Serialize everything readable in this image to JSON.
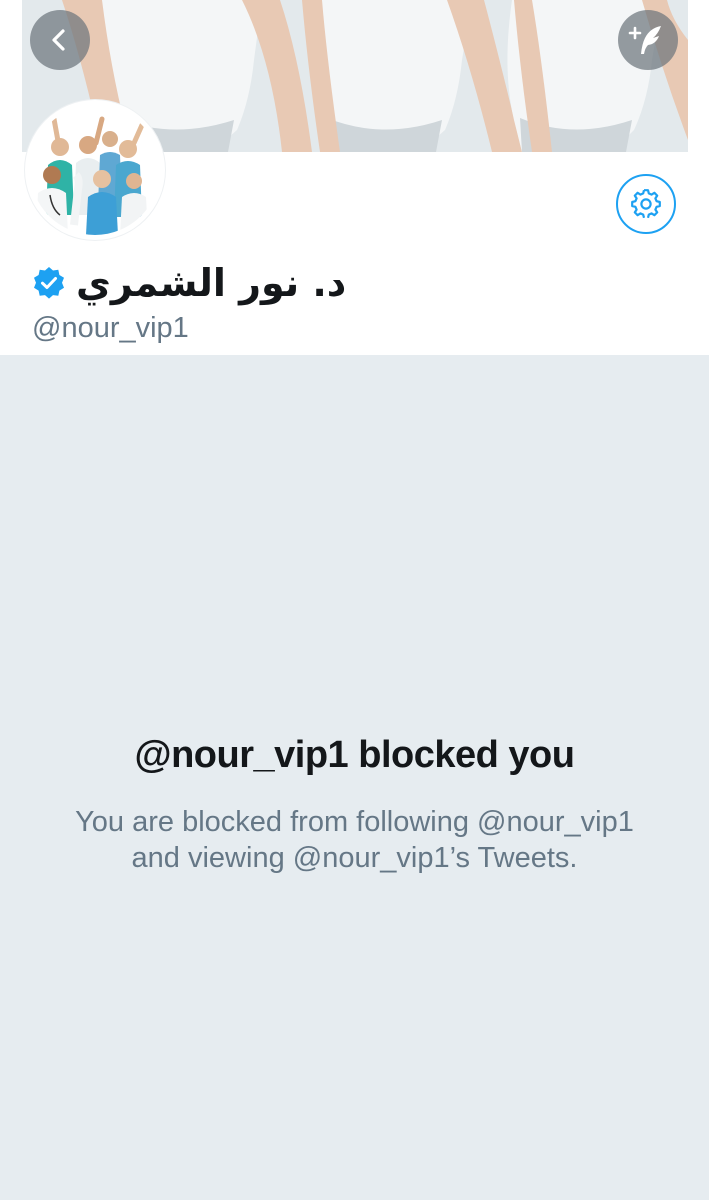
{
  "header": {
    "back_icon": "chevron-left-icon",
    "compose_icon": "compose-tweet-icon",
    "settings_icon": "gear-icon"
  },
  "profile": {
    "display_name": "د. نور الشمري",
    "handle": "@nour_vip1",
    "verified": true,
    "verified_icon": "verified-badge-icon"
  },
  "blocked": {
    "title": "@nour_vip1 blocked you",
    "description": "You are blocked from following @nour_vip1 and viewing @nour_vip1’s Tweets."
  },
  "colors": {
    "accent": "#1da1f2",
    "background": "#e6ecf0",
    "text_primary": "#14171a",
    "text_secondary": "#657786"
  }
}
